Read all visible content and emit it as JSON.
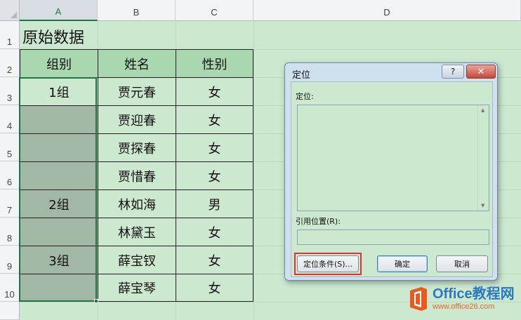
{
  "columns": [
    "A",
    "B",
    "C",
    "D"
  ],
  "rows": [
    "1",
    "2",
    "3",
    "4",
    "5",
    "6",
    "7",
    "8",
    "9",
    "10"
  ],
  "sheet": {
    "title": "原始数据",
    "headers": [
      "组别",
      "姓名",
      "性别"
    ],
    "groups": [
      "1组",
      "2组",
      "3组"
    ],
    "names": [
      "贾元春",
      "贾迎春",
      "贾探春",
      "贾惜春",
      "林如海",
      "林黛玉",
      "薛宝钗",
      "薛宝琴"
    ],
    "genders": [
      "女",
      "女",
      "女",
      "女",
      "男",
      "女",
      "女",
      "女"
    ]
  },
  "dialog": {
    "title": "定位",
    "help_label": "?",
    "close_label": "✕",
    "goto_label": "定位:",
    "reference_label": "引用位置(R):",
    "reference_value": "",
    "special_button": "定位条件(S)...",
    "ok_button": "确定",
    "cancel_button": "取消"
  },
  "watermark": {
    "brand": "Office教程网",
    "url": "www.office26.com"
  },
  "colors": {
    "sheet_bg": "#cce8cf",
    "header_fill": "#a9d8b0",
    "blank_fill": "#a2b7a4",
    "selection": "#217346",
    "highlight": "#e03030"
  }
}
